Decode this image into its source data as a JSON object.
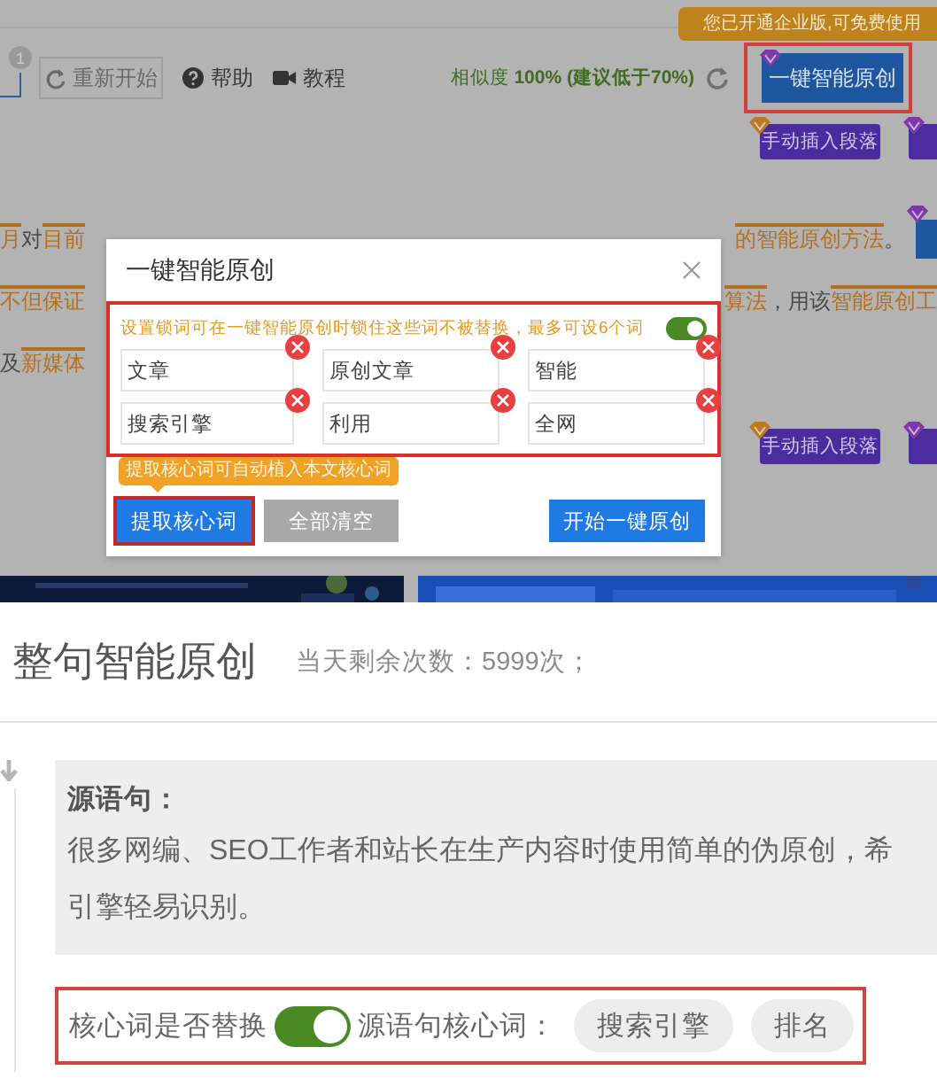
{
  "background_page": {
    "notice": "您已开通企业版,可免费使用",
    "toolbar": {
      "badge": "1",
      "restart_button": {
        "label": "重新开始",
        "disabled": true
      },
      "help": "帮助",
      "tutorial": "教程",
      "similarity": {
        "label": "相似度",
        "value": "100%",
        "advice": "(建议低于70%)"
      },
      "one_click_button": "一键智能原创"
    },
    "insert_buttons": [
      {
        "label": "手动插入段落"
      },
      {
        "label": "手动插入段落"
      }
    ],
    "paragraph_lines": [
      {
        "left": [
          {
            "text": "月",
            "highlight": true
          },
          {
            "text": "对",
            "highlight": false
          },
          {
            "text": "目前",
            "highlight": true
          }
        ],
        "right": [
          {
            "text": "的智能原创方法",
            "highlight": true
          },
          {
            "text": "。",
            "highlight": false
          }
        ]
      },
      {
        "left": [
          {
            "text": "不但保证",
            "highlight": true
          }
        ],
        "right": [
          {
            "text": "算法",
            "highlight": true
          },
          {
            "text": "，用该",
            "highlight": false
          },
          {
            "text": "智能原创工",
            "highlight": true
          }
        ]
      },
      {
        "left": [
          {
            "text": "及",
            "highlight": false
          },
          {
            "text": "新媒体",
            "highlight": true
          }
        ]
      }
    ]
  },
  "dialog": {
    "title": "一键智能原创",
    "hint": "设置锁词可在一键智能原创时锁住这些词不被替换，最多可设6个词",
    "lock_words_on": true,
    "keywords": [
      "文章",
      "原创文章",
      "智能",
      "搜索引擎",
      "利用",
      "全网"
    ],
    "tooltip": "提取核心词可自动植入本文核心词",
    "buttons": [
      {
        "label": "提取核心词",
        "kind": "primary",
        "highlighted": true
      },
      {
        "label": "全部清空",
        "kind": "secondary",
        "highlighted": false
      },
      {
        "label": "开始一键原创",
        "kind": "primary",
        "highlighted": false
      }
    ]
  },
  "panel": {
    "title": "整句智能原创",
    "remaining": "当天剩余次数：5999次；",
    "source_label": "源语句：",
    "source_lines": [
      "很多网编、SEO工作者和站长在生产内容时使用简单的伪原创，希",
      "引擎轻易识别。"
    ],
    "replace_label": "核心词是否替换",
    "replace_on": true,
    "keywords_label": "源语句核心词：",
    "core_keywords": [
      "搜索引擎",
      "排名"
    ]
  }
}
